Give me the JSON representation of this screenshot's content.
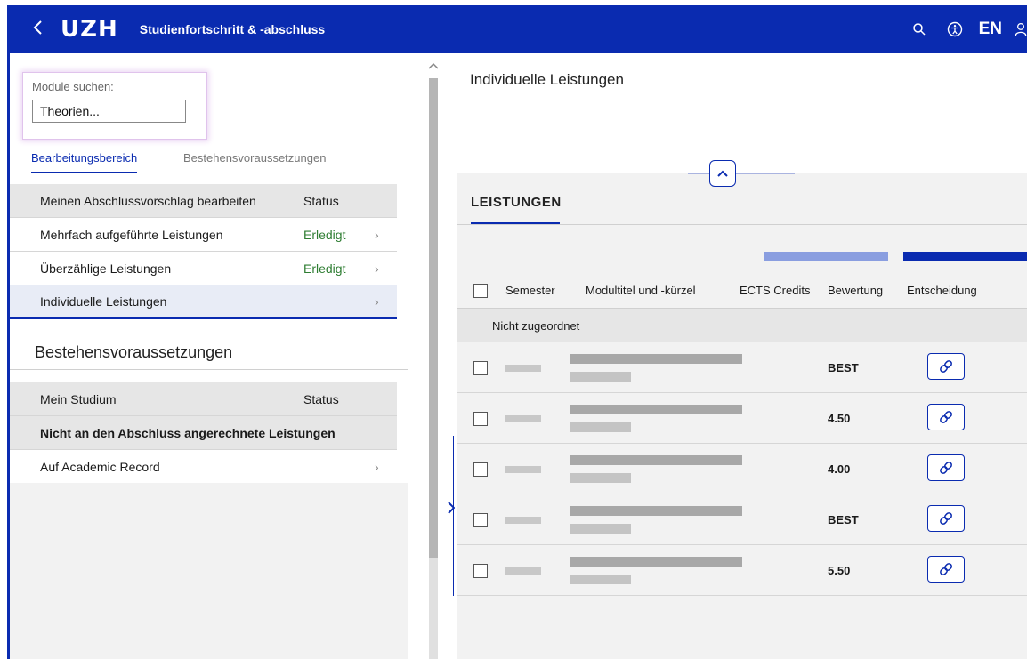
{
  "header": {
    "logo": "UZH",
    "title": "Studienfortschritt & -abschluss",
    "lang": "EN",
    "back_icon": "chevron-left-icon",
    "icons": [
      "search-icon",
      "accessibility-icon",
      "user-icon"
    ]
  },
  "search": {
    "label": "Module suchen:",
    "value": "Theorien..."
  },
  "tabs": [
    {
      "label": "Bearbeitungsbereich"
    },
    {
      "label": "Bestehensvoraussetzungen"
    }
  ],
  "edit_table": {
    "header": "Meinen Abschlussvorschlag bearbeiten",
    "status_header": "Status",
    "rows": [
      {
        "label": "Mehrfach aufgeführte Leistungen",
        "status": "Erledigt"
      },
      {
        "label": "Überzählige Leistungen",
        "status": "Erledigt"
      },
      {
        "label": "Individuelle Leistungen",
        "status": ""
      }
    ]
  },
  "requirements": {
    "title": "Bestehensvoraussetzungen",
    "header": "Mein Studium",
    "status_header": "Status",
    "group": "Nicht an den Abschluss angerechnete Leistungen",
    "item": "Auf Academic Record"
  },
  "right": {
    "title": "Individuelle Leistungen",
    "section": "LEISTUNGEN",
    "columns": [
      "Semester",
      "Modultitel und -kürzel",
      "ECTS Credits",
      "Bewertung",
      "Entscheidung"
    ],
    "group": "Nicht zugeordnet",
    "rows": [
      {
        "grade": "BEST"
      },
      {
        "grade": "4.50"
      },
      {
        "grade": "4.00"
      },
      {
        "grade": "BEST"
      },
      {
        "grade": "5.50"
      }
    ]
  },
  "colors": {
    "brand": "#0a2bb0",
    "done": "#2e7d32"
  }
}
